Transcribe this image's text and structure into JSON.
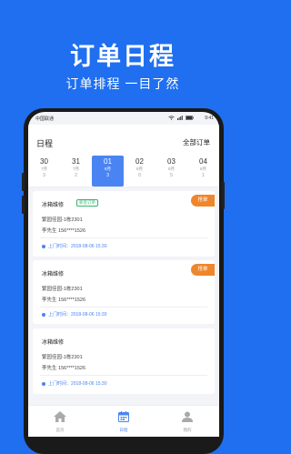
{
  "promo": {
    "title": "订单日程",
    "subtitle": "订单排程 一目了然"
  },
  "status_bar": {
    "carrier": "中国联通",
    "time": "9:41"
  },
  "header": {
    "title": "日程",
    "all_orders": "全部订单"
  },
  "dates": [
    {
      "day": "30",
      "month": "7月",
      "count": "3",
      "selected": false
    },
    {
      "day": "31",
      "month": "7月",
      "count": "2",
      "selected": false
    },
    {
      "day": "01",
      "month": "8月",
      "count": "3",
      "selected": true
    },
    {
      "day": "02",
      "month": "8月",
      "count": "0",
      "selected": false
    },
    {
      "day": "03",
      "month": "8月",
      "count": "5",
      "selected": false
    },
    {
      "day": "04",
      "month": "8月",
      "count": "1",
      "selected": false
    }
  ],
  "orders": [
    {
      "service": "冰箱维修",
      "tag": "新签订单",
      "action": "抢单",
      "address": "繁园佳园-1栋2301",
      "contact": "李先生  156****1526",
      "time": "上门时间：2018-08-06  15:30"
    },
    {
      "service": "冰箱维修",
      "tag": "",
      "action": "抢单",
      "address": "繁园佳园-1栋2301",
      "contact": "李先生  156****1526",
      "time": "上门时间：2018-08-06  15:30"
    },
    {
      "service": "冰箱维修",
      "tag": "",
      "action": "",
      "address": "繁园佳园-1栋2301",
      "contact": "李先生  156****1526",
      "time": "上门时间：2018-08-06  15:30"
    }
  ],
  "tabs": [
    {
      "label": "首页",
      "icon": "home-icon",
      "active": false
    },
    {
      "label": "日程",
      "icon": "calendar-icon",
      "active": true
    },
    {
      "label": "我的",
      "icon": "user-icon",
      "active": false
    }
  ],
  "colors": {
    "brand_blue": "#1f6ff0",
    "selected_date": "#4a84f2",
    "grab_orange": "#f0862c",
    "tag_green": "#36b36c"
  }
}
